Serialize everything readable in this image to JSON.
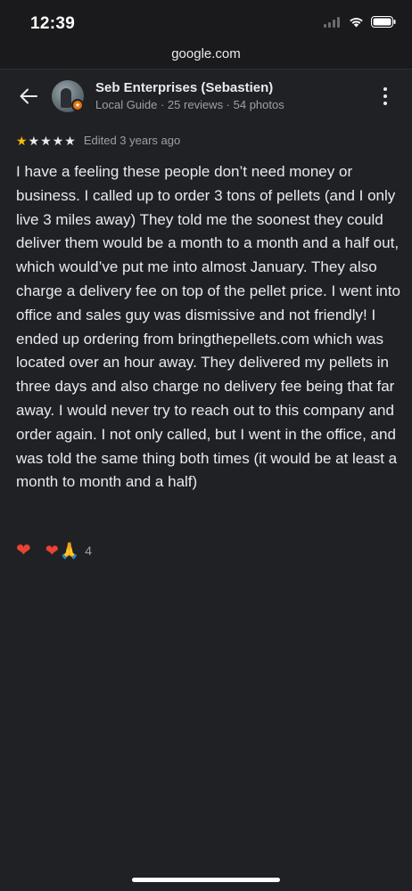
{
  "status_bar": {
    "time": "12:39"
  },
  "browser": {
    "url": "google.com"
  },
  "reviewer": {
    "name": "Seb Enterprises (Sebastien)",
    "meta": "Local Guide · 25 reviews · 54 photos",
    "badge_icon": "local-guide-star"
  },
  "review": {
    "rating": 1,
    "max_rating": 5,
    "edited": "Edited 3 years ago",
    "text": "I have a feeling these people don’t need money or business. I called up to order 3 tons of pellets (and I only live 3 miles away) They told me the soonest they could deliver them would be a month to a month and a half out, which would’ve put me into almost January. They also charge a delivery fee on top of the pellet price. I went into office and sales guy was dismissive and not friendly! I ended up ordering from bringthepellets.com which was located over an hour away. They delivered my pellets in three days and also charge no delivery fee being that far away. I would never try to reach out to this company and order again. I not only called, but I went in the office, and was told the same thing both times (it would be at least a month to month and a half)"
  },
  "reactions": {
    "react_icon": "heart",
    "summary_icons": [
      "heart",
      "pray"
    ],
    "count": "4"
  },
  "colors": {
    "background": "#202124",
    "star_filled": "#fbbc04",
    "heart": "#ea4335",
    "secondary_text": "#9aa0a6"
  }
}
